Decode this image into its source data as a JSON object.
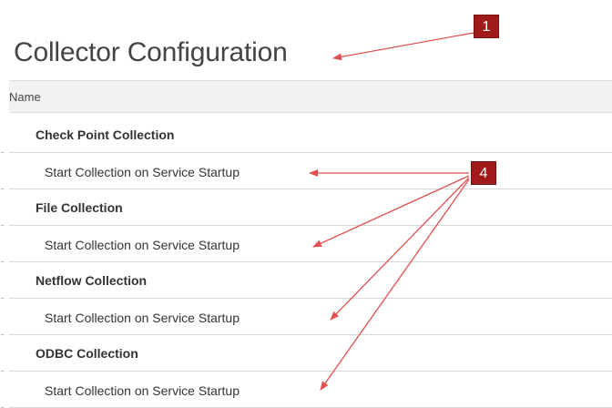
{
  "page": {
    "title": "Collector Configuration"
  },
  "table": {
    "header_name": "Name",
    "rows": [
      {
        "type": "group",
        "label": "Check Point Collection"
      },
      {
        "type": "setting",
        "label": "Start Collection on Service Startup"
      },
      {
        "type": "group",
        "label": "File Collection"
      },
      {
        "type": "setting",
        "label": "Start Collection on Service Startup"
      },
      {
        "type": "group",
        "label": "Netflow Collection"
      },
      {
        "type": "setting",
        "label": "Start Collection on Service Startup"
      },
      {
        "type": "group",
        "label": "ODBC Collection"
      },
      {
        "type": "setting",
        "label": "Start Collection on Service Startup"
      }
    ]
  },
  "annotations": {
    "callout_1": "1",
    "callout_4": "4",
    "color": "#a01a1a",
    "arrow_color": "#e05050"
  }
}
